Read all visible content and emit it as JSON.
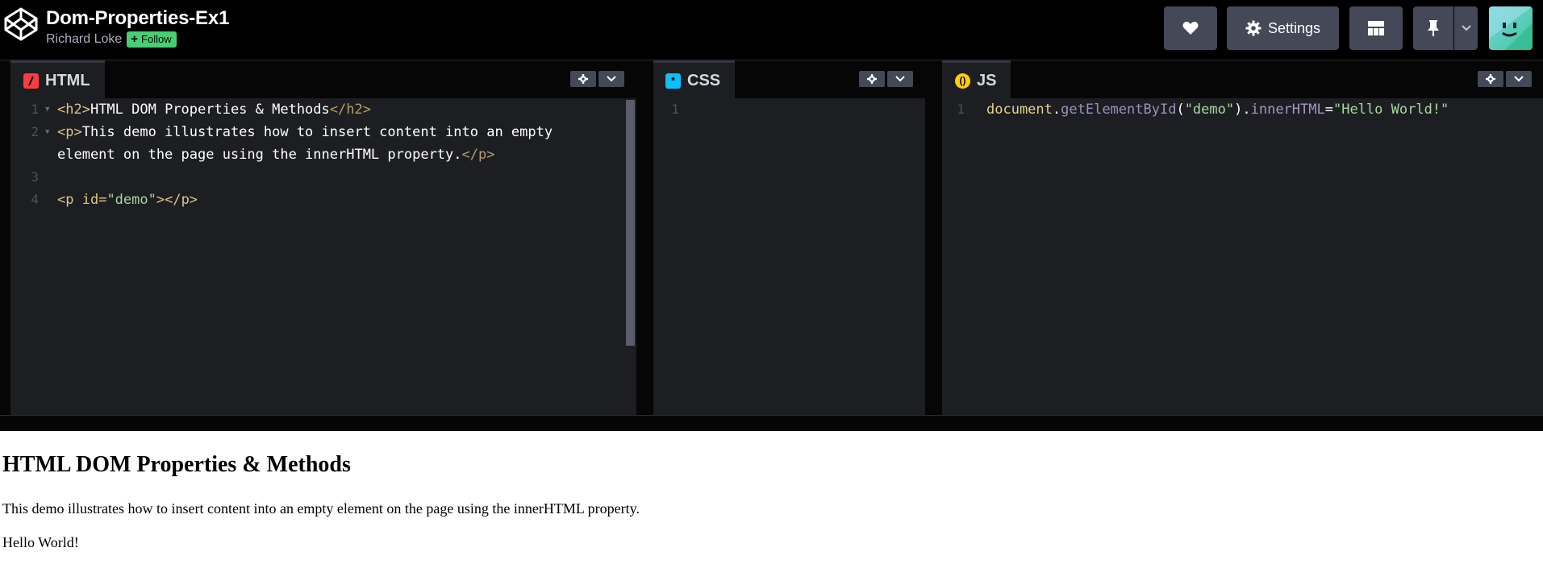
{
  "header": {
    "title": "Dom-Properties-Ex1",
    "author": "Richard Loke",
    "follow_label": "Follow",
    "follow_plus": "+",
    "settings_label": "Settings"
  },
  "editors": {
    "html": {
      "label": "HTML",
      "line_numbers": [
        "1",
        "2",
        "3",
        "4"
      ],
      "lines": {
        "l1_open": "<h2>",
        "l1_text": "HTML DOM Properties & Methods",
        "l1_close": "</h2>",
        "l2_open": "<p>",
        "l2_text": "This demo illustrates how to insert content into an empty",
        "l2b_text": "element on the page using the innerHTML property.",
        "l2_close": "</p>",
        "l4_open": "<p ",
        "l4_attr": "id=",
        "l4_val": "\"demo\"",
        "l4_close": "></p>"
      }
    },
    "css": {
      "label": "CSS",
      "line_numbers": [
        "1"
      ]
    },
    "js": {
      "label": "JS",
      "line_numbers": [
        "1"
      ],
      "code": {
        "obj": "document",
        "dot1": ".",
        "fn": "getElementById",
        "paren_open": "(",
        "arg": "\"demo\"",
        "paren_close": ")",
        "dot2": ".",
        "prop": "innerHTML",
        "eq": "=",
        "val": "\"Hello World!\""
      }
    }
  },
  "preview": {
    "heading": "HTML DOM Properties & Methods",
    "paragraph": "This demo illustrates how to insert content into an empty element on the page using the innerHTML property.",
    "demo_output": "Hello World!"
  },
  "colors": {
    "follow_green": "#47cf73",
    "button_bg": "#444857",
    "editor_bg": "#1d1e22",
    "html_icon": "#ff3c41",
    "css_icon": "#0ebeff",
    "js_icon": "#fcd000"
  }
}
